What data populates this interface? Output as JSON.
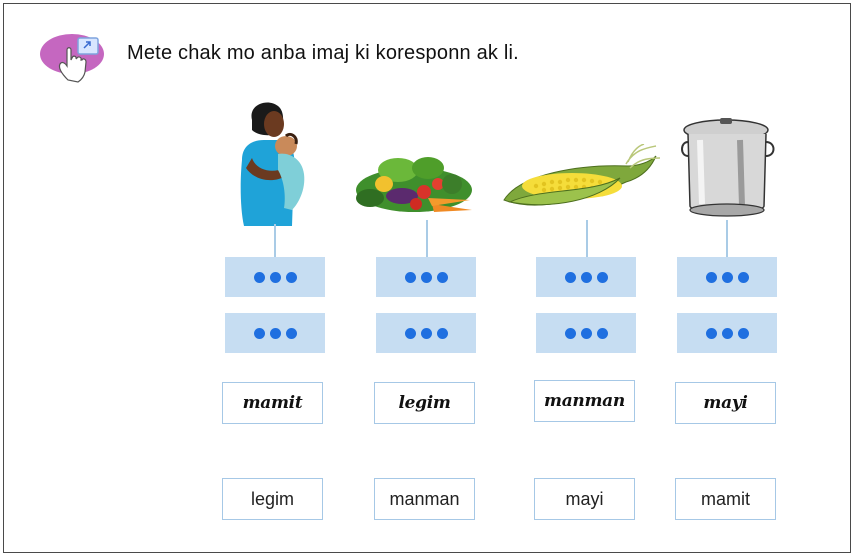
{
  "instruction": "Mete chak mo anba imaj ki koresponn ak li.",
  "pictures": [
    {
      "name": "mother-with-baby-image"
    },
    {
      "name": "vegetables-image"
    },
    {
      "name": "corn-image"
    },
    {
      "name": "pot-image"
    }
  ],
  "cursive_words": [
    "mamit",
    "legim",
    "manman",
    "mayi"
  ],
  "print_words": [
    "legim",
    "manman",
    "mayi",
    "mamit"
  ],
  "colors": {
    "slot": "#c6ddf2",
    "dot": "#1f6fe0",
    "card_border": "#a6c8e6",
    "icon": "#c567c0"
  }
}
